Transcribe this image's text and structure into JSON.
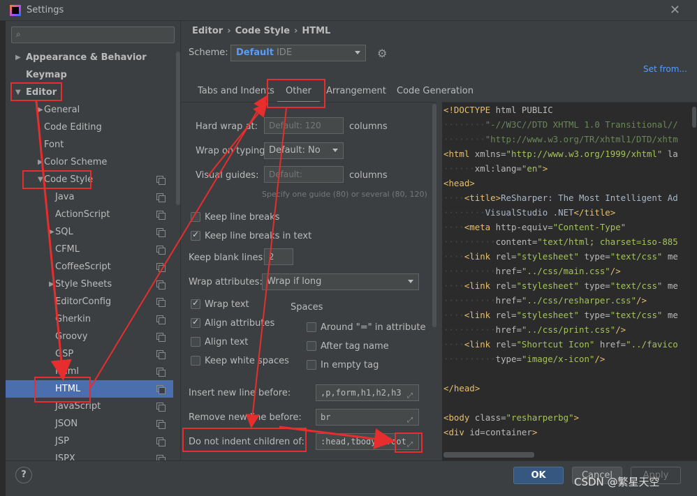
{
  "window": {
    "title": "Settings",
    "close_glyph": "✕"
  },
  "sidebar": {
    "search_placeholder": "",
    "items": [
      {
        "label": "Appearance & Behavior",
        "level": 0,
        "bold": true,
        "arrow": "▶"
      },
      {
        "label": "Keymap",
        "level": 0,
        "bold": true,
        "arrow": ""
      },
      {
        "label": "Editor",
        "level": 0,
        "bold": true,
        "arrow": "▼"
      },
      {
        "label": "General",
        "level": 1,
        "arrow": "▶"
      },
      {
        "label": "Code Editing",
        "level": 1,
        "arrow": ""
      },
      {
        "label": "Font",
        "level": 1,
        "arrow": ""
      },
      {
        "label": "Color Scheme",
        "level": 1,
        "arrow": "▶"
      },
      {
        "label": "Code Style",
        "level": 1,
        "arrow": "▼"
      },
      {
        "label": "Java",
        "level": 2
      },
      {
        "label": "ActionScript",
        "level": 2
      },
      {
        "label": "SQL",
        "level": 2,
        "arrow": "▶"
      },
      {
        "label": "CFML",
        "level": 2
      },
      {
        "label": "CoffeeScript",
        "level": 2
      },
      {
        "label": "Style Sheets",
        "level": 2,
        "arrow": "▶"
      },
      {
        "label": "EditorConfig",
        "level": 2
      },
      {
        "label": "Gherkin",
        "level": 2
      },
      {
        "label": "Groovy",
        "level": 2
      },
      {
        "label": "GSP",
        "level": 2
      },
      {
        "label": "Haml",
        "level": 2
      },
      {
        "label": "HTML",
        "level": 2,
        "selected": true
      },
      {
        "label": "JavaScript",
        "level": 2
      },
      {
        "label": "JSON",
        "level": 2
      },
      {
        "label": "JSP",
        "level": 2
      },
      {
        "label": "JSPX",
        "level": 2
      }
    ]
  },
  "breadcrumb": [
    "Editor",
    "Code Style",
    "HTML"
  ],
  "breadcrumb_sep": "›",
  "scheme": {
    "label": "Scheme:",
    "value": "Default",
    "sub": "IDE",
    "set_from": "Set from..."
  },
  "tabs": [
    "Tabs and Indents",
    "Other",
    "Arrangement",
    "Code Generation"
  ],
  "active_tab": "Other",
  "options": {
    "hard_wrap_label": "Hard wrap at:",
    "hard_wrap_placeholder": "Default: 120",
    "columns1": "columns",
    "wrap_typing_label": "Wrap on typing:",
    "wrap_typing_value": "Default: No",
    "visual_guides_label": "Visual guides:",
    "visual_guides_placeholder": "Default:",
    "columns2": "columns",
    "guides_hint": "Specify one guide (80) or several (80, 120)",
    "keep_line_breaks": "Keep line breaks",
    "keep_line_breaks_text": "Keep line breaks in text",
    "keep_blank_lines_label": "Keep blank lines:",
    "keep_blank_lines_value": "2",
    "wrap_attributes_label": "Wrap attributes:",
    "wrap_attributes_value": "Wrap if long",
    "wrap_text": "Wrap text",
    "align_attributes": "Align attributes",
    "align_text": "Align text",
    "keep_white_spaces": "Keep white spaces",
    "spaces_header": "Spaces",
    "around_eq": "Around \"=\" in attribute",
    "after_tag_name": "After tag name",
    "in_empty_tag": "In empty tag",
    "insert_new_line_label": "Insert new line before:",
    "insert_new_line_value": ",p,form,h1,h2,h3",
    "remove_new_line_label": "Remove new line before:",
    "remove_new_line_value": "br",
    "do_not_indent_label": "Do not indent children of:",
    "do_not_indent_value": ":head,tbody,tfoot"
  },
  "buttons": {
    "help": "?",
    "ok": "OK",
    "cancel": "Cancel",
    "apply": "Apply"
  },
  "watermark": "CSDN @繁星天空",
  "colors": {
    "accent": "#4b6eaf",
    "link": "#589df6",
    "annotation_red": "#e62e2e",
    "ok_button": "#365880"
  }
}
